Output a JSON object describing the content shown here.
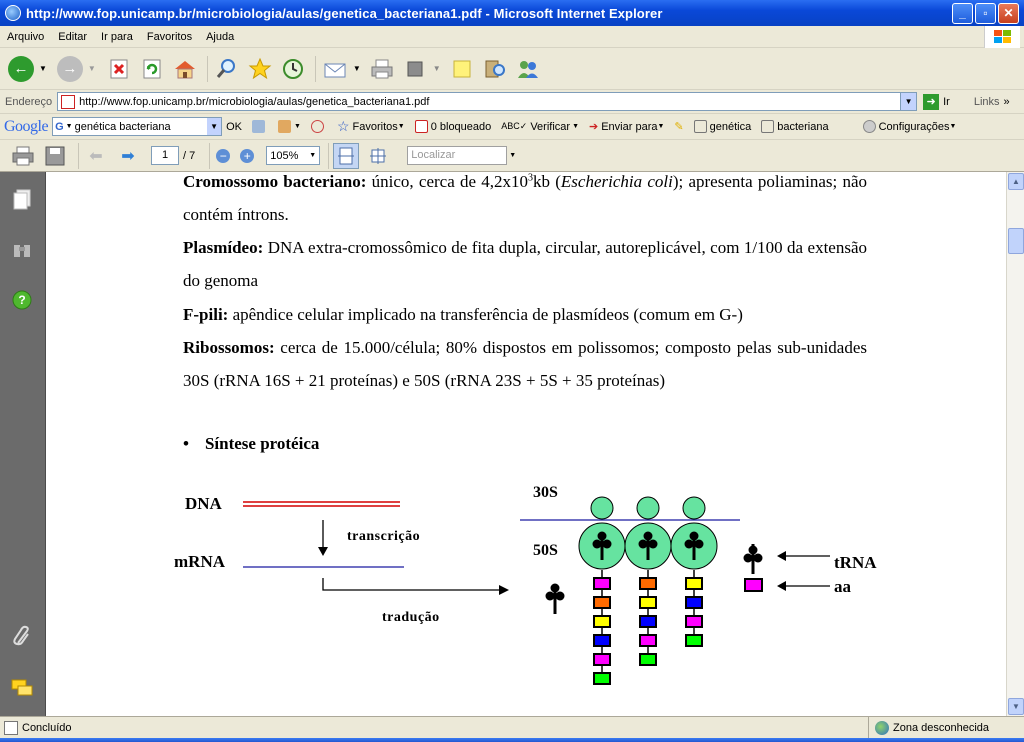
{
  "window": {
    "title": "http://www.fop.unicamp.br/microbiologia/aulas/genetica_bacteriana1.pdf - Microsoft Internet Explorer",
    "minimize": "_",
    "maximize": "▫",
    "close": "✕"
  },
  "menu": [
    "Arquivo",
    "Editar",
    "Ir para",
    "Favoritos",
    "Ajuda"
  ],
  "address": {
    "label": "Endereço",
    "url": "http://www.fop.unicamp.br/microbiologia/aulas/genetica_bacteriana1.pdf",
    "go_label": "Ir",
    "links_label": "Links"
  },
  "google_toolbar": {
    "logo": "Google",
    "search_value": "genética bacteriana",
    "ok_label": "OK",
    "favorites_label": "Favoritos",
    "blocked_label": "0 bloqueado",
    "check_label": "Verificar",
    "send_label": "Enviar para",
    "term1": "genética",
    "term2": "bacteriana",
    "settings_label": "Configurações"
  },
  "pdf_toolbar": {
    "page_current": "1",
    "page_total": "/ 7",
    "zoom": "105%",
    "find_placeholder": "Localizar"
  },
  "document": {
    "p1_term": "Cromossomo bacteriano:",
    "p1_text_a": " único, cerca de 4,2x10",
    "p1_sup": "3",
    "p1_text_b": "kb (",
    "p1_italic": "Escherichia coli",
    "p1_text_c": "); apresenta poliaminas; não contém íntrons.",
    "p2_term": "Plasmídeo:",
    "p2_text": " DNA extra-cromossômico de fita dupla, circular, autoreplicável, com 1/100 da extensão do genoma",
    "p3_term": "F-pili:",
    "p3_text": " apêndice celular implicado na transferência de plasmídeos (comum em G-)",
    "p4_term": "Ribossomos:",
    "p4_text": " cerca de 15.000/célula; 80% dispostos em polissomos; composto pelas sub-unidades 30S (rRNA 16S + 21 proteínas) e 50S (rRNA 23S + 5S + 35 proteínas)",
    "bullet": "•",
    "section_title": "Síntese protéica"
  },
  "diagram": {
    "dna": "DNA",
    "mrna": "mRNA",
    "transcription": "transcrição",
    "translation": "tradução",
    "s30": "30S",
    "s50": "50S",
    "trna": "tRNA",
    "aa": "aa",
    "colors": {
      "ribosome": "#66e3a0",
      "dna": "#d40000",
      "mrna": "#1a1aa0",
      "magenta": "#ff00ff",
      "orange": "#ff6a00",
      "yellow": "#ffff00",
      "blue": "#0000ff",
      "green": "#00ff00"
    }
  },
  "status": {
    "left": "Concluído",
    "zone": "Zona desconhecida"
  }
}
